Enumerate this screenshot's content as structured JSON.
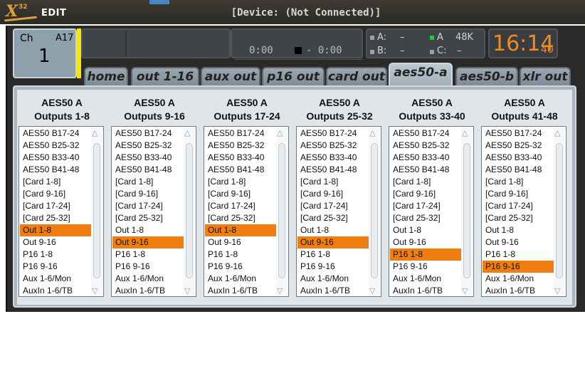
{
  "app": {
    "logo_x": "X",
    "logo_32": "32",
    "logo_edit": "EDIT"
  },
  "window_title": "[Device: (Not Connected)]",
  "channel": {
    "label": "Ch",
    "code": "A17",
    "number": "1"
  },
  "transport": {
    "time_left": "0:00",
    "time_right": "- 0:00",
    "stop_icon": "stop-icon"
  },
  "status": {
    "a_label": "A:",
    "a_value": "–",
    "b_label": "B:",
    "b_value": "–",
    "sync_label": "A",
    "sync_value": "48K",
    "c_label": "C:",
    "c_value": "–"
  },
  "clock": {
    "time": "16:14",
    "seconds": "40",
    "color": "#f08c1c"
  },
  "tabs": [
    {
      "label": "home"
    },
    {
      "label": "out 1-16"
    },
    {
      "label": "aux out"
    },
    {
      "label": "p16 out"
    },
    {
      "label": "card out"
    },
    {
      "label": "aes50-a"
    },
    {
      "label": "aes50-b"
    },
    {
      "label": "xlr out"
    }
  ],
  "active_tab": "aes50-a",
  "selection_color": "#f07d10",
  "options": [
    "AES50 B17-24",
    "AES50 B25-32",
    "AES50 B33-40",
    "AES50 B41-48",
    "[Card 1-8]",
    "[Card 9-16]",
    "[Card 17-24]",
    "[Card 25-32]",
    "Out 1-8",
    "Out 9-16",
    "P16 1-8",
    "P16 9-16",
    "Aux 1-6/Mon",
    "AuxIn 1-6/TB"
  ],
  "columns": [
    {
      "title": "AES50 A",
      "subtitle": "Outputs 1-8",
      "selected": "Out 1-8"
    },
    {
      "title": "AES50 A",
      "subtitle": "Outputs 9-16",
      "selected": "Out 9-16"
    },
    {
      "title": "AES50 A",
      "subtitle": "Outputs 17-24",
      "selected": "Out 1-8"
    },
    {
      "title": "AES50 A",
      "subtitle": "Outputs 25-32",
      "selected": "Out 9-16"
    },
    {
      "title": "AES50 A",
      "subtitle": "Outputs 33-40",
      "selected": "P16 1-8"
    },
    {
      "title": "AES50 A",
      "subtitle": "Outputs 41-48",
      "selected": "P16 9-16"
    }
  ]
}
